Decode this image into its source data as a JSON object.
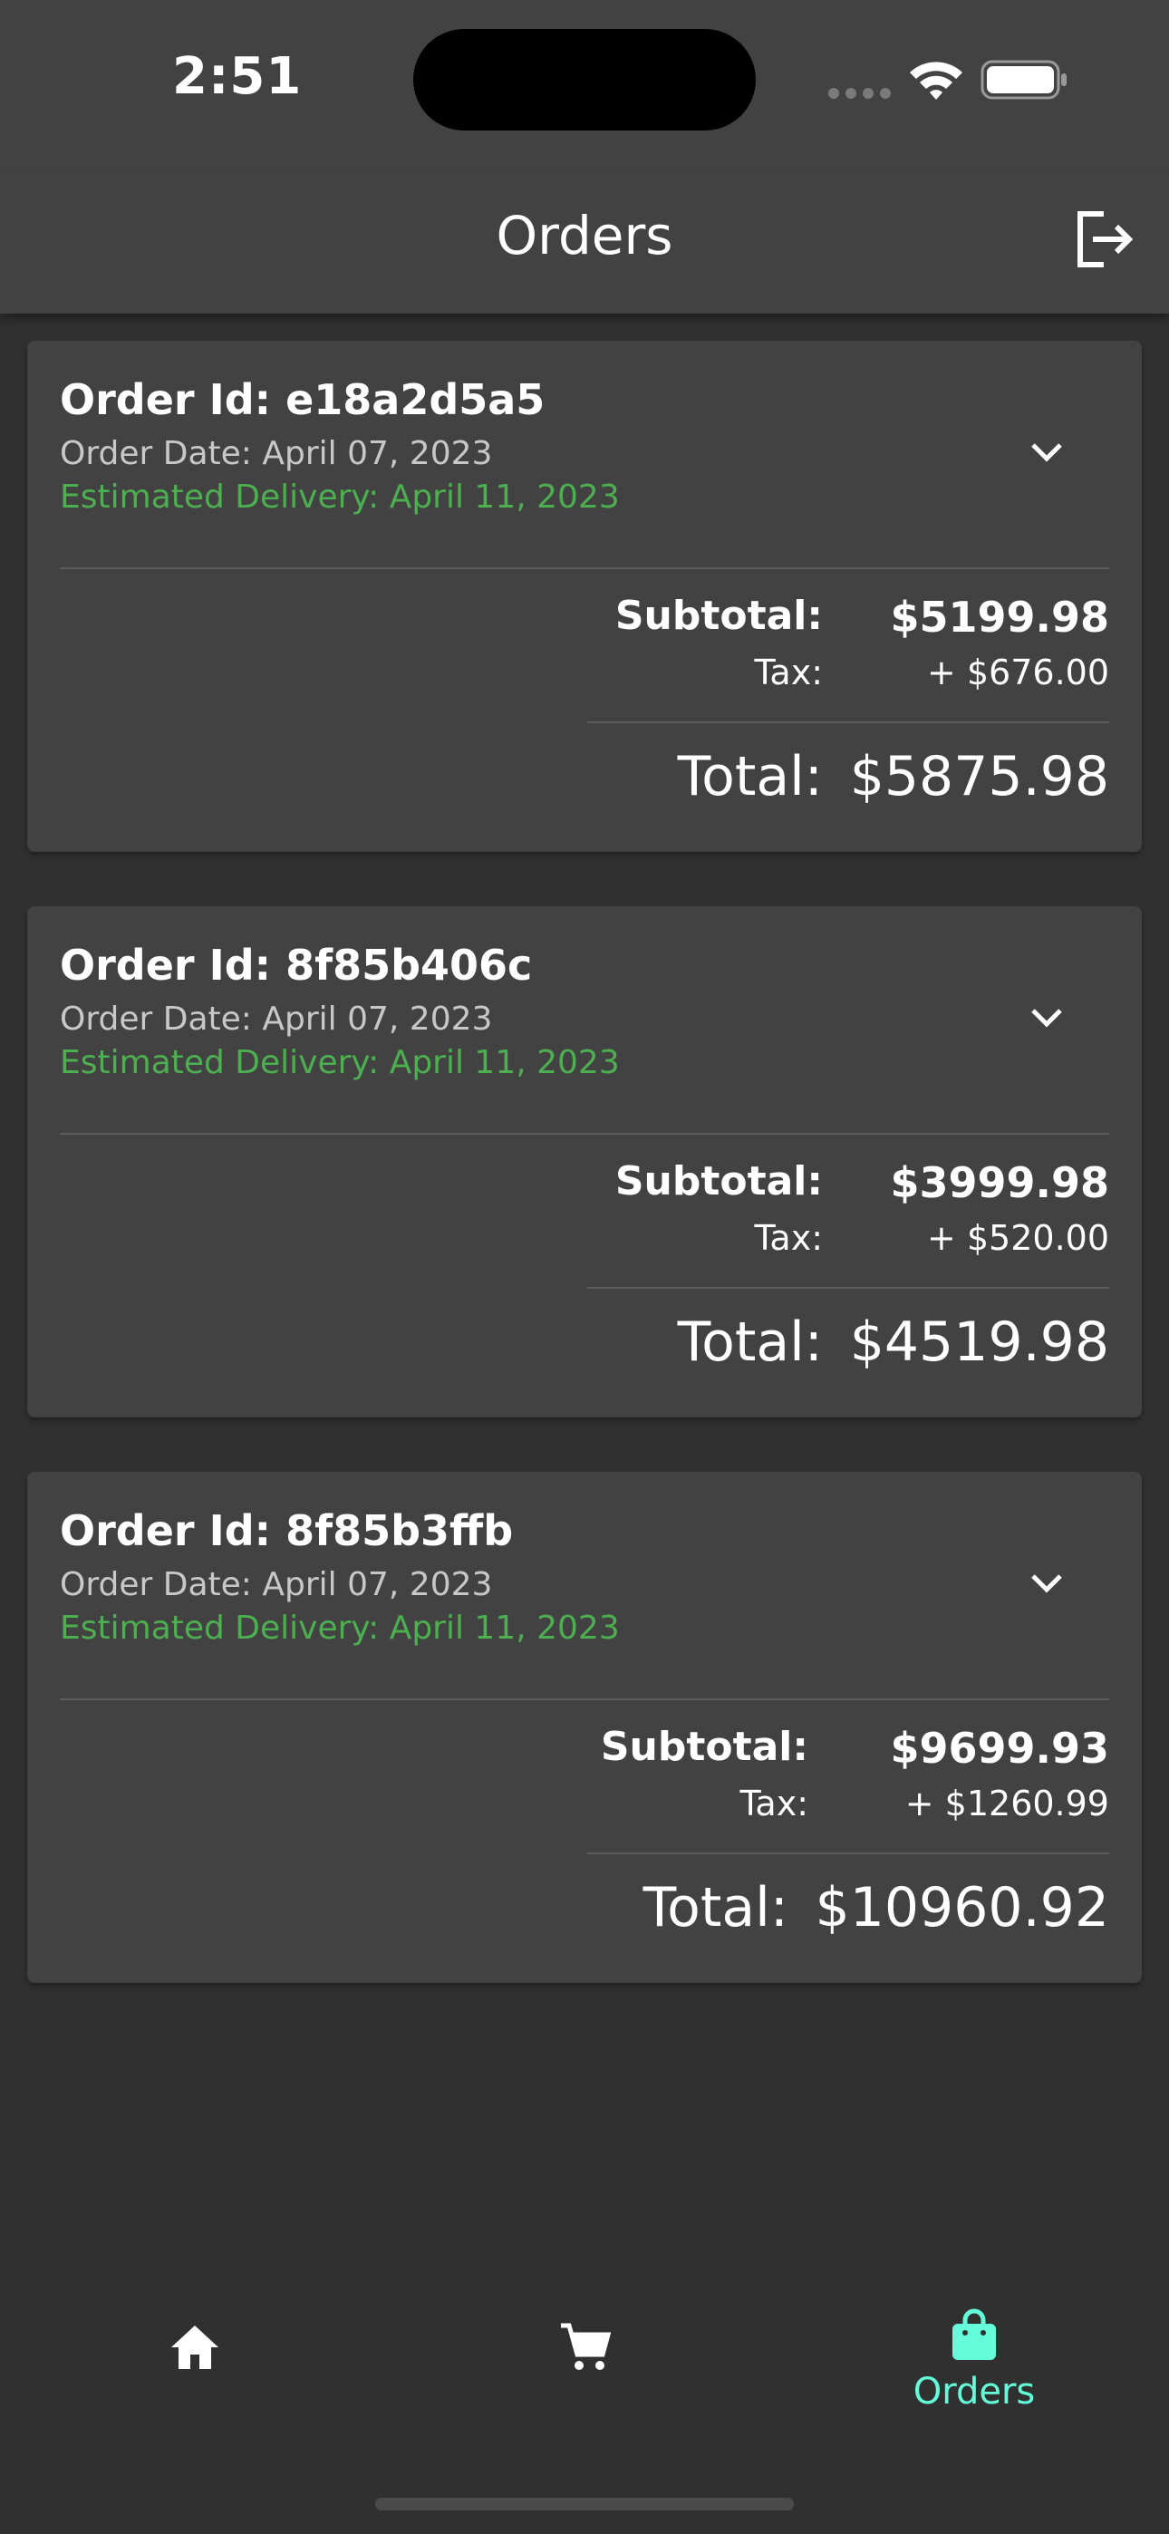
{
  "status_bar": {
    "time": "2:51"
  },
  "app_bar": {
    "title": "Orders",
    "logout_icon": "logout-icon"
  },
  "labels": {
    "subtotal": "Subtotal:",
    "tax": "Tax:",
    "total": "Total:"
  },
  "orders": [
    {
      "order_id": "Order Id: e18a2d5a5",
      "order_date": "Order Date: April 07, 2023",
      "estimated_delivery": "Estimated Delivery: April 11, 2023",
      "subtotal": "$5199.98",
      "tax": "+ $676.00",
      "total": "$5875.98"
    },
    {
      "order_id": "Order Id: 8f85b406c",
      "order_date": "Order Date: April 07, 2023",
      "estimated_delivery": "Estimated Delivery: April 11, 2023",
      "subtotal": "$3999.98",
      "tax": "+ $520.00",
      "total": "$4519.98"
    },
    {
      "order_id": "Order Id: 8f85b3ffb",
      "order_date": "Order Date: April 07, 2023",
      "estimated_delivery": "Estimated Delivery: April 11, 2023",
      "subtotal": "$9699.93",
      "tax": "+ $1260.99",
      "total": "$10960.92"
    }
  ],
  "bottom_nav": {
    "items": [
      {
        "icon": "home-icon",
        "label": ""
      },
      {
        "icon": "cart-icon",
        "label": ""
      },
      {
        "icon": "shopping-bag-icon",
        "label": "Orders",
        "active": true
      }
    ]
  },
  "colors": {
    "background": "#303030",
    "surface": "#424242",
    "delivery_green": "#4caf50",
    "accent": "#64ffda"
  }
}
